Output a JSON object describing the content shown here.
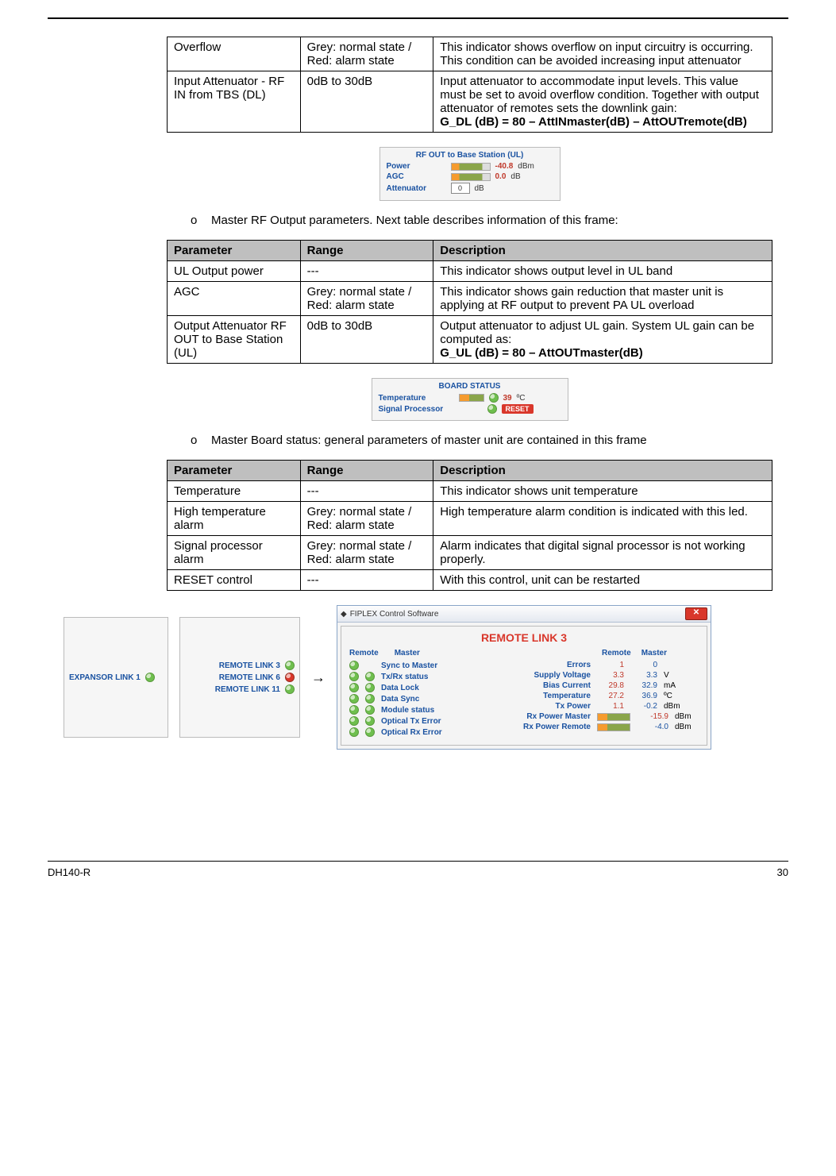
{
  "table0": {
    "rows": [
      {
        "param": "Overflow",
        "range": "Grey: normal state / Red: alarm state",
        "desc": "This indicator shows overflow on input circuitry is occurring. This condition can be avoided increasing input attenuator"
      },
      {
        "param": "Input Attenuator - RF IN from TBS (DL)",
        "range": "0dB to 30dB",
        "desc_pre": "Input attenuator to accommodate input levels. This value must be set to avoid overflow condition. Together with output attenuator of remotes sets the downlink gain:",
        "desc_bold": "G_DL (dB) = 80 – AttINmaster(dB) – AttOUTremote(dB)"
      }
    ]
  },
  "panel_ul": {
    "title": "RF OUT to Base Station (UL)",
    "power_label": "Power",
    "power_value": "-40.8",
    "power_unit": "dBm",
    "agc_label": "AGC",
    "agc_value": "0.0",
    "agc_unit": "dB",
    "att_label": "Attenuator",
    "att_value": "0",
    "att_unit": "dB"
  },
  "bullet1": "Master RF Output parameters. Next table describes information of this frame:",
  "table1": {
    "headers": {
      "p": "Parameter",
      "r": "Range",
      "d": "Description"
    },
    "rows": [
      {
        "param": "UL Output power",
        "range": "---",
        "desc": "This indicator shows output level in UL band"
      },
      {
        "param": "AGC",
        "range": "Grey: normal state / Red: alarm state",
        "desc": "This indicator shows gain reduction that master unit is applying at RF output to prevent PA UL overload"
      },
      {
        "param": "Output Attenuator RF OUT to Base Station (UL)",
        "range": "0dB to 30dB",
        "desc_pre": "Output attenuator to adjust UL gain. System UL gain can be computed as:",
        "desc_bold": "G_UL (dB) = 80 – AttOUTmaster(dB)"
      }
    ]
  },
  "panel_board": {
    "title": "BOARD STATUS",
    "temp_label": "Temperature",
    "temp_value": "39",
    "temp_unit": "ºC",
    "sp_label": "Signal Processor",
    "reset_label": "RESET"
  },
  "bullet2": "Master Board status: general parameters of master unit are contained in this frame",
  "table2": {
    "headers": {
      "p": "Parameter",
      "r": "Range",
      "d": "Description"
    },
    "rows": [
      {
        "param": "Temperature",
        "range": "---",
        "desc": "This indicator shows unit temperature"
      },
      {
        "param": "High temperature alarm",
        "range": "Grey: normal state / Red: alarm state",
        "desc": "High temperature alarm condition is indicated with this led."
      },
      {
        "param": "Signal processor alarm",
        "range": "Grey: normal state / Red: alarm state",
        "desc": "Alarm indicates that digital signal processor is not working properly."
      },
      {
        "param": "RESET control",
        "range": "---",
        "desc": "With this control, unit can be restarted"
      }
    ]
  },
  "flow": {
    "expansor_label": "EXPANSOR LINK 1",
    "remote_links": [
      "REMOTE LINK 3",
      "REMOTE LINK 6",
      "REMOTE LINK 11"
    ],
    "arrow": "→"
  },
  "window": {
    "app_title": "FIPLEX Control Software",
    "page_title": "REMOTE LINK 3",
    "col_headers": {
      "remote": "Remote",
      "master": "Master"
    },
    "colA_rows": [
      {
        "name": "Sync to Master",
        "r": true,
        "m": false
      },
      {
        "name": "Tx/Rx status",
        "r": true,
        "m": true
      },
      {
        "name": "Data Lock",
        "r": true,
        "m": true
      },
      {
        "name": "Data Sync",
        "r": true,
        "m": true
      },
      {
        "name": "Module status",
        "r": true,
        "m": true
      },
      {
        "name": "Optical Tx Error",
        "r": true,
        "m": true
      },
      {
        "name": "Optical Rx Error",
        "r": true,
        "m": true
      }
    ],
    "colB_rows": [
      {
        "name": "Errors",
        "vr": "1",
        "vb": "0",
        "u": ""
      },
      {
        "name": "Supply Voltage",
        "vr": "3.3",
        "vb": "3.3",
        "u": "V"
      },
      {
        "name": "Bias Current",
        "vr": "29.8",
        "vb": "32.9",
        "u": "mA"
      },
      {
        "name": "Temperature",
        "vr": "27.2",
        "vb": "36.9",
        "u": "ºC"
      },
      {
        "name": "Tx Power",
        "vr": "1.1",
        "vb": "-0.2",
        "u": "dBm"
      }
    ],
    "rx_master": {
      "name": "Rx Power Master",
      "val": "-15.9",
      "u": "dBm"
    },
    "rx_remote": {
      "name": "Rx Power Remote",
      "val": "-4.0",
      "u": "dBm"
    }
  },
  "footer": {
    "left": "DH140-R",
    "right": "30"
  },
  "bullet_marker": "o"
}
